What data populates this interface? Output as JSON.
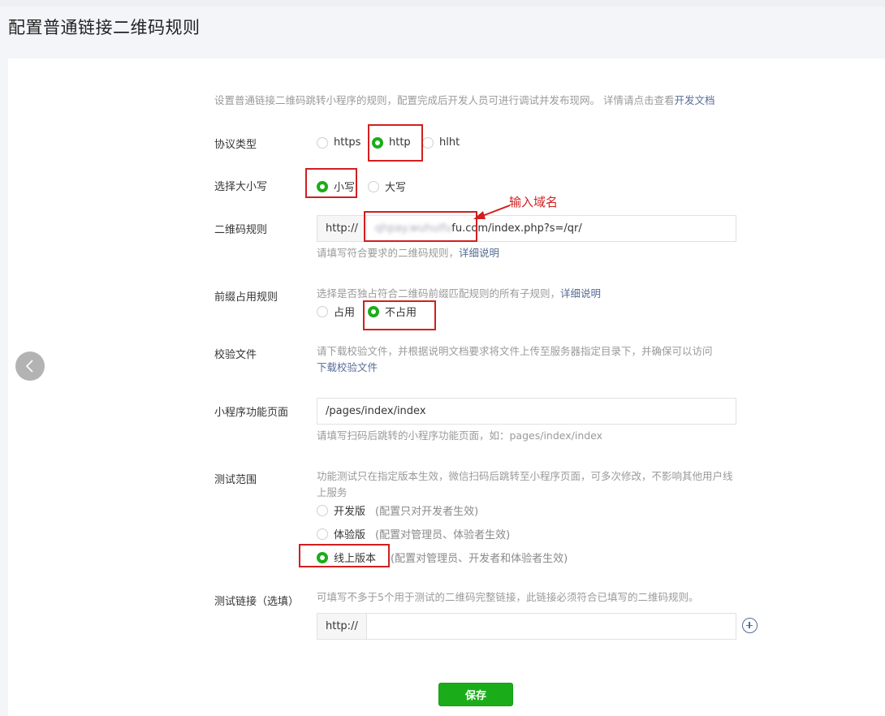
{
  "page_title": "配置普通链接二维码规则",
  "intro": {
    "text": "设置普通链接二维码跳转小程序的规则，配置完成后开发人员可进行调试并发布现网。 详情请点击查看",
    "link": "开发文档"
  },
  "protocol": {
    "label": "协议类型",
    "options": [
      "https",
      "http",
      "hlht"
    ],
    "selected": "http"
  },
  "case": {
    "label": "选择大小写",
    "options": [
      "小写",
      "大写"
    ],
    "selected": "小写"
  },
  "qr_rule": {
    "label": "二维码规则",
    "prefix": "http://",
    "value_blurred": "qhpay.wuhuifu",
    "value": "fu.com/index.php?s=/qr/",
    "hint": "请填写符合要求的二维码规则，",
    "hint_link": "详细说明",
    "annotation": "输入域名"
  },
  "prefix_rule": {
    "label": "前缀占用规则",
    "desc": "选择是否独占符合二维码前缀匹配规则的所有子规则，",
    "desc_link": "详细说明",
    "options": [
      "占用",
      "不占用"
    ],
    "selected": "不占用"
  },
  "verify_file": {
    "label": "校验文件",
    "desc": "请下载校验文件，并根据说明文档要求将文件上传至服务器指定目录下，并确保可以访问",
    "link": "下载校验文件"
  },
  "page_path": {
    "label": "小程序功能页面",
    "value": "/pages/index/index",
    "hint": "请填写扫码后跳转的小程序功能页面，如：pages/index/index"
  },
  "test_scope": {
    "label": "测试范围",
    "desc_line1": "功能测试只在指定版本生效，微信扫码后跳转至小程序页面，可多次修改，不影响其他用户线",
    "desc_line2": "上服务",
    "options": [
      {
        "label": "开发版",
        "note": "(配置只对开发者生效)"
      },
      {
        "label": "体验版",
        "note": "(配置对管理员、体验者生效)"
      },
      {
        "label": "线上版本",
        "note": "(配置对管理员、开发者和体验者生效)"
      }
    ],
    "selected": "线上版本"
  },
  "test_link": {
    "label": "测试链接（选填）",
    "desc": "可填写不多于5个用于测试的二维码完整链接，此链接必须符合已填写的二维码规则。",
    "prefix": "http://",
    "value": ""
  },
  "save_label": "保存",
  "colors": {
    "accent": "#1aad19",
    "link": "#576b95",
    "annotation": "#d21f1f"
  }
}
